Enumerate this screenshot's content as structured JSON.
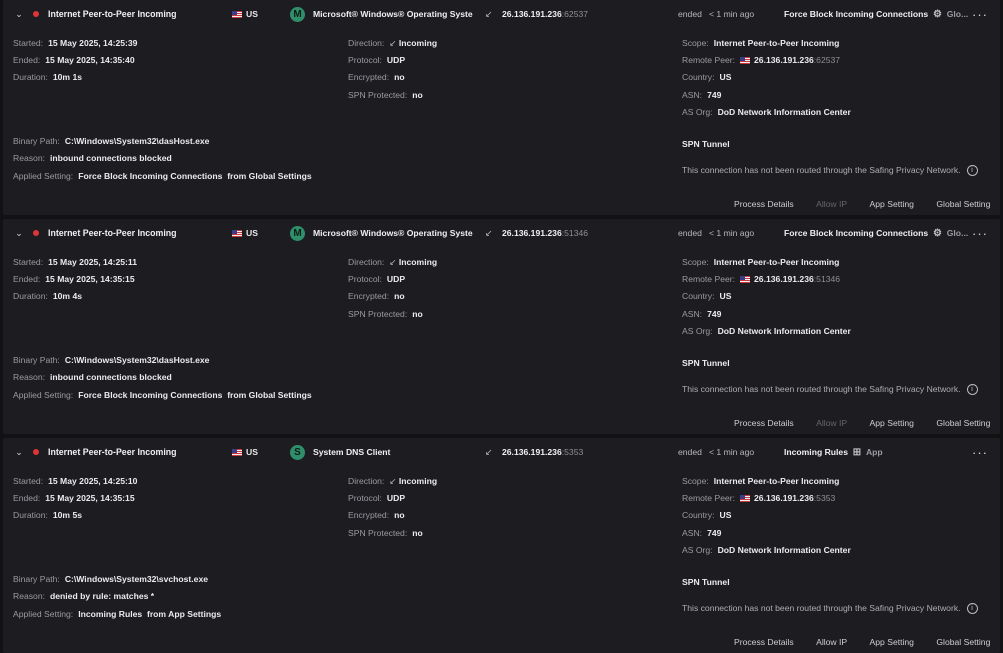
{
  "connections": [
    {
      "scope": "Internet Peer-to-Peer Incoming",
      "country": "US",
      "process_initial": "M",
      "process_color": "#2f8f6b",
      "process": "Microsoft® Windows® Operating System",
      "direction_icon": "incoming-arrow-icon",
      "remote_ip": "26.136.191.236",
      "remote_port": ":62537",
      "ended_label": "ended",
      "ended_ago": "< 1 min ago",
      "verdict": "Force Block Incoming Connections",
      "verdict_icon": "gear-icon",
      "verdict_source": "Glo...",
      "started": "15 May 2025, 14:25:39",
      "ended": "15 May 2025, 14:35:40",
      "duration": "10m 1s",
      "direction": "Incoming",
      "protocol": "UDP",
      "encrypted": "no",
      "spn_protected": "no",
      "scope_detail": "Internet Peer-to-Peer  Incoming",
      "remote_peer": "26.136.191.236",
      "remote_peer_port": ":62537",
      "remote_country": "US",
      "asn": "749",
      "as_org": "DoD Network Information Center",
      "binary_path": "C:\\Windows\\System32\\dasHost.exe",
      "reason": "inbound connections blocked",
      "applied_setting": "Force Block Incoming Connections",
      "applied_from": "from Global Settings",
      "spn_title": "SPN Tunnel",
      "spn_note": "This connection has not been routed through the Safing Privacy Network.",
      "allow_ip_enabled": false
    },
    {
      "scope": "Internet Peer-to-Peer Incoming",
      "country": "US",
      "process_initial": "M",
      "process_color": "#2f8f6b",
      "process": "Microsoft® Windows® Operating System",
      "direction_icon": "incoming-arrow-icon",
      "remote_ip": "26.136.191.236",
      "remote_port": ":51346",
      "ended_label": "ended",
      "ended_ago": "< 1 min ago",
      "verdict": "Force Block Incoming Connections",
      "verdict_icon": "gear-icon",
      "verdict_source": "Glo...",
      "started": "15 May 2025, 14:25:11",
      "ended": "15 May 2025, 14:35:15",
      "duration": "10m 4s",
      "direction": "Incoming",
      "protocol": "UDP",
      "encrypted": "no",
      "spn_protected": "no",
      "scope_detail": "Internet Peer-to-Peer  Incoming",
      "remote_peer": "26.136.191.236",
      "remote_peer_port": ":51346",
      "remote_country": "US",
      "asn": "749",
      "as_org": "DoD Network Information Center",
      "binary_path": "C:\\Windows\\System32\\dasHost.exe",
      "reason": "inbound connections blocked",
      "applied_setting": "Force Block Incoming Connections",
      "applied_from": "from Global Settings",
      "spn_title": "SPN Tunnel",
      "spn_note": "This connection has not been routed through the Safing Privacy Network.",
      "allow_ip_enabled": false
    },
    {
      "scope": "Internet Peer-to-Peer Incoming",
      "country": "US",
      "process_initial": "S",
      "process_color": "#2f8f6b",
      "process": "System DNS Client",
      "direction_icon": "incoming-arrow-icon",
      "remote_ip": "26.136.191.236",
      "remote_port": ":5353",
      "ended_label": "ended",
      "ended_ago": "< 1 min ago",
      "verdict": "Incoming Rules",
      "verdict_icon": "app-grid-icon",
      "verdict_source": "App",
      "started": "15 May 2025, 14:25:10",
      "ended": "15 May 2025, 14:35:15",
      "duration": "10m 5s",
      "direction": "Incoming",
      "protocol": "UDP",
      "encrypted": "no",
      "spn_protected": "no",
      "scope_detail": "Internet Peer-to-Peer  Incoming",
      "remote_peer": "26.136.191.236",
      "remote_peer_port": ":5353",
      "remote_country": "US",
      "asn": "749",
      "as_org": "DoD Network Information Center",
      "binary_path": "C:\\Windows\\System32\\svchost.exe",
      "reason": "denied by rule: matches *",
      "applied_setting": "Incoming Rules",
      "applied_from": "from App Settings",
      "spn_title": "SPN Tunnel",
      "spn_note": "This connection has not been routed through the Safing Privacy Network.",
      "allow_ip_enabled": true
    }
  ],
  "labels": {
    "started": "Started:",
    "ended": "Ended:",
    "duration": "Duration:",
    "direction": "Direction:",
    "protocol": "Protocol:",
    "encrypted": "Encrypted:",
    "spn_protected": "SPN Protected:",
    "scope": "Scope:",
    "remote_peer": "Remote Peer:",
    "country": "Country:",
    "asn": "ASN:",
    "as_org": "AS Org:",
    "binary_path": "Binary Path:",
    "reason": "Reason:",
    "applied_setting": "Applied Setting:"
  },
  "actions": {
    "process_details": "Process Details",
    "allow_ip": "Allow IP",
    "app_setting": "App Setting",
    "global_setting": "Global Setting"
  },
  "colors": {
    "blocked_dot": "#e0343b",
    "card_bg": "#1d1d21",
    "page_bg": "#121214"
  }
}
